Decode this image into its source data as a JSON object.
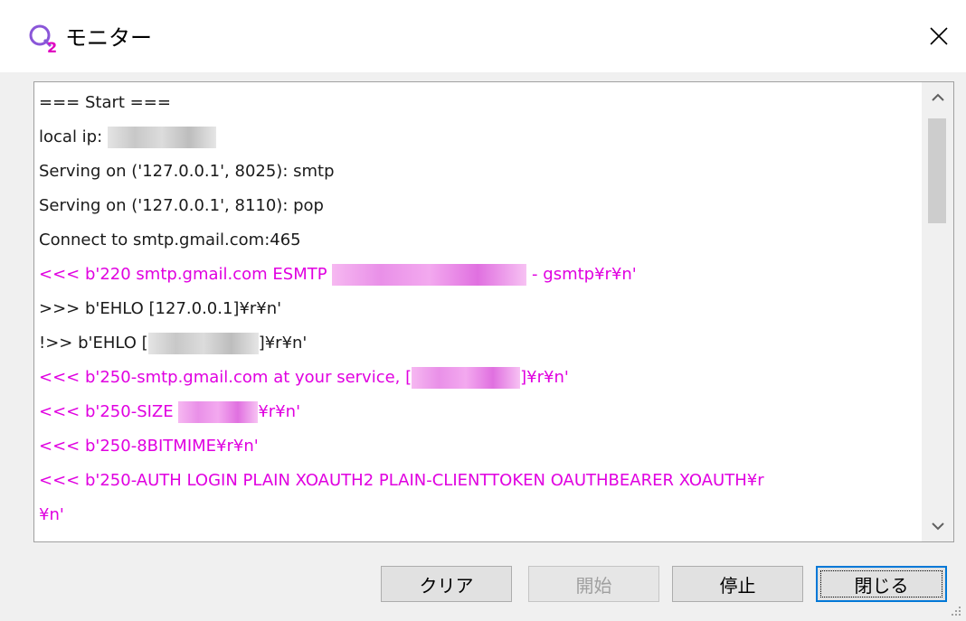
{
  "window": {
    "title": "モニター",
    "icon": "app-logo-icon",
    "close_icon": "close-icon"
  },
  "log": {
    "lines": [
      {
        "kind": "info",
        "parts": [
          {
            "t": "=== Start ==="
          }
        ]
      },
      {
        "kind": "info",
        "parts": [
          {
            "t": "local ip: "
          },
          {
            "redacted": "gray",
            "w": 120
          }
        ]
      },
      {
        "kind": "info",
        "parts": [
          {
            "t": "Serving on ('127.0.0.1', 8025): smtp"
          }
        ]
      },
      {
        "kind": "info",
        "parts": [
          {
            "t": "Serving on ('127.0.0.1', 8110): pop"
          }
        ]
      },
      {
        "kind": "info",
        "parts": [
          {
            "t": "Connect to smtp.gmail.com:465"
          }
        ]
      },
      {
        "kind": "recv",
        "parts": [
          {
            "t": "<<< b'220 smtp.gmail.com ESMTP "
          },
          {
            "redacted": "pink",
            "w": 215
          },
          {
            "t": " - gsmtp¥r¥n'"
          }
        ]
      },
      {
        "kind": "info",
        "parts": [
          {
            "t": ">>> b'EHLO [127.0.0.1]¥r¥n'"
          }
        ]
      },
      {
        "kind": "info",
        "parts": [
          {
            "t": "!>> b'EHLO ["
          },
          {
            "redacted": "gray",
            "w": 122
          },
          {
            "t": "]¥r¥n'"
          }
        ]
      },
      {
        "kind": "recv",
        "parts": [
          {
            "t": "<<< b'250-smtp.gmail.com at your service, ["
          },
          {
            "redacted": "pink",
            "w": 120
          },
          {
            "t": "]¥r¥n'"
          }
        ]
      },
      {
        "kind": "recv",
        "parts": [
          {
            "t": "<<< b'250-SIZE "
          },
          {
            "redacted": "pink",
            "w": 88
          },
          {
            "t": "¥r¥n'"
          }
        ]
      },
      {
        "kind": "recv",
        "parts": [
          {
            "t": "<<< b'250-8BITMIME¥r¥n'"
          }
        ]
      },
      {
        "kind": "recv",
        "parts": [
          {
            "t": "<<< b'250-AUTH LOGIN PLAIN XOAUTH2 PLAIN-CLIENTTOKEN OAUTHBEARER XOAUTH¥r"
          }
        ]
      },
      {
        "kind": "recv",
        "parts": [
          {
            "t": "¥n'"
          }
        ]
      }
    ]
  },
  "scrollbar": {
    "up_icon": "chevron-up-icon",
    "down_icon": "chevron-down-icon"
  },
  "buttons": {
    "clear": "クリア",
    "start": "開始",
    "stop": "停止",
    "close": "閉じる"
  },
  "colors": {
    "received": "#e000e0",
    "normal": "#1a1a1a",
    "focus_border": "#0078d7"
  }
}
